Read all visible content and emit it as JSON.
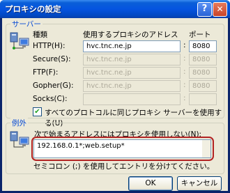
{
  "title": "プロキシの設定",
  "titlebar_buttons": {
    "help": "?",
    "close": "✕"
  },
  "servers": {
    "group_label": "サーバー",
    "col_type": "種類",
    "col_address": "使用するプロキシのアドレス",
    "col_port": "ポート",
    "rows": [
      {
        "label": "HTTP(H):",
        "address": "hvc.tnc.ne.jp",
        "port": "8080",
        "enabled": true
      },
      {
        "label": "Secure(S):",
        "address": "hvc.tnc.ne.jp",
        "port": "8080",
        "enabled": false
      },
      {
        "label": "FTP(F):",
        "address": "hvc.tnc.ne.jp",
        "port": "8080",
        "enabled": false
      },
      {
        "label": "Gopher(G):",
        "address": "hvc.tnc.ne.jp",
        "port": "8080",
        "enabled": false
      },
      {
        "label": "Socks(C):",
        "address": "",
        "port": "",
        "enabled": false
      }
    ],
    "same_proxy_label": "すべてのプロトコルに同じプロキシ サーバーを使用する(U)",
    "same_proxy_checked": true
  },
  "exceptions": {
    "group_label": "例外",
    "prompt": "次で始まるアドレスにはプロキシを使用しない(N):",
    "value": "192.168.0.1*;web.setup*",
    "hint": "セミコロン (;) を使用してエントリを分けてください。"
  },
  "buttons": {
    "ok": "OK",
    "cancel": "キャンセル"
  }
}
